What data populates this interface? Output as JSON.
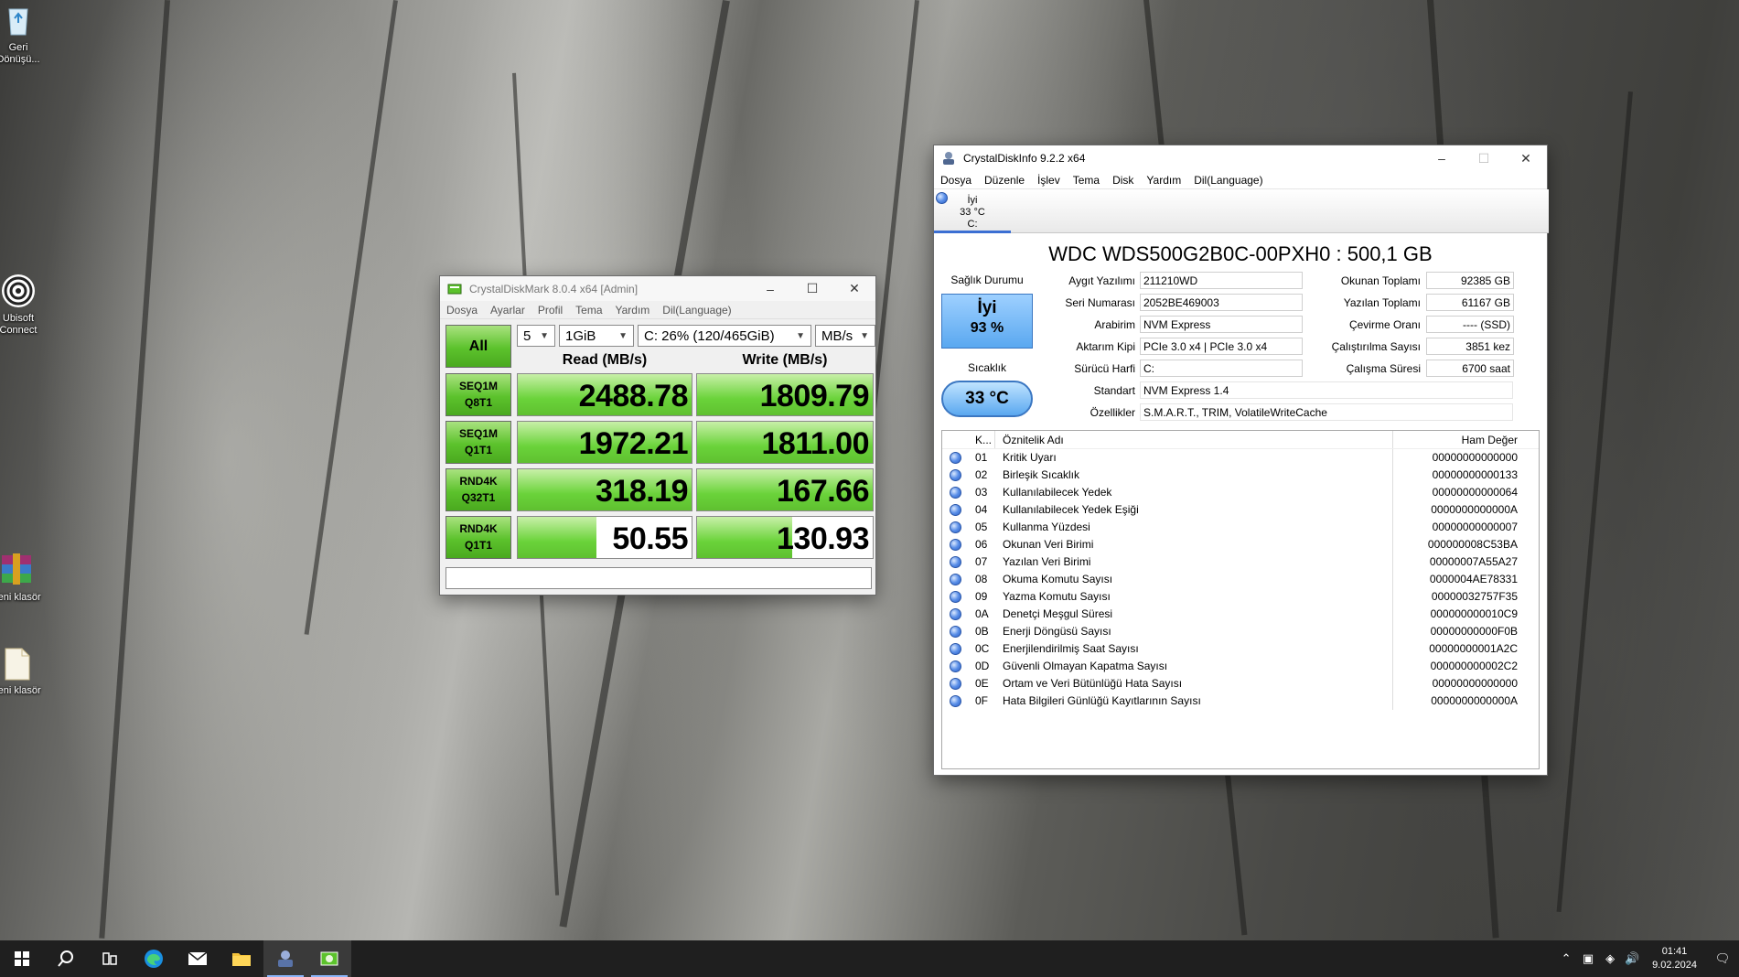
{
  "desktop": {
    "icons": [
      {
        "label": "Geri Dönüşü..."
      },
      {
        "label": "Ubisoft Connect"
      },
      {
        "label": "Yeni klasör"
      },
      {
        "label": "Yeni klasör"
      }
    ]
  },
  "cdm": {
    "title": "CrystalDiskMark 8.0.4 x64 [Admin]",
    "menu": [
      "Dosya",
      "Ayarlar",
      "Profil",
      "Tema",
      "Yardım",
      "Dil(Language)"
    ],
    "all_label": "All",
    "count": "5",
    "size": "1GiB",
    "drive": "C: 26% (120/465GiB)",
    "unit": "MB/s",
    "read_header": "Read (MB/s)",
    "write_header": "Write (MB/s)",
    "rows": [
      {
        "l1": "SEQ1M",
        "l2": "Q8T1",
        "read": "2488.78",
        "write": "1809.79",
        "read_fill": 1.0,
        "write_fill": 1.0
      },
      {
        "l1": "SEQ1M",
        "l2": "Q1T1",
        "read": "1972.21",
        "write": "1811.00",
        "read_fill": 1.0,
        "write_fill": 1.0
      },
      {
        "l1": "RND4K",
        "l2": "Q32T1",
        "read": "318.19",
        "write": "167.66",
        "read_fill": 1.0,
        "write_fill": 1.0
      },
      {
        "l1": "RND4K",
        "l2": "Q1T1",
        "read": "50.55",
        "write": "130.93",
        "read_fill": 0.45,
        "write_fill": 0.54
      }
    ]
  },
  "cdi": {
    "title": "CrystalDiskInfo 9.2.2 x64",
    "menu": [
      "Dosya",
      "Düzenle",
      "İşlev",
      "Tema",
      "Disk",
      "Yardım",
      "Dil(Language)"
    ],
    "tab": {
      "status": "İyi",
      "temp": "33 °C",
      "drive": "C:"
    },
    "model": "WDC WDS500G2B0C-00PXH0 : 500,1 GB",
    "health_label": "Sağlık Durumu",
    "health_status": "İyi",
    "health_percent": "93 %",
    "temp_label": "Sıcaklık",
    "temp_value": "33 °C",
    "fields": {
      "firmware_label": "Aygıt Yazılımı",
      "firmware": "211210WD",
      "serial_label": "Seri Numarası",
      "serial": "2052BE469003",
      "interface_label": "Arabirim",
      "interface": "NVM Express",
      "transfer_label": "Aktarım Kipi",
      "transfer": "PCIe 3.0 x4 | PCIe 3.0 x4",
      "drive_label": "Sürücü Harfi",
      "drive": "C:",
      "standard_label": "Standart",
      "standard": "NVM Express 1.4",
      "features_label": "Özellikler",
      "features": "S.M.A.R.T., TRIM, VolatileWriteCache",
      "host_reads_label": "Okunan Toplamı",
      "host_reads": "92385 GB",
      "host_writes_label": "Yazılan Toplamı",
      "host_writes": "61167 GB",
      "rotation_label": "Çevirme Oranı",
      "rotation": "---- (SSD)",
      "power_count_label": "Çalıştırılma Sayısı",
      "power_count": "3851 kez",
      "power_hours_label": "Çalışma Süresi",
      "power_hours": "6700 saat"
    },
    "table": {
      "col_id": "K...",
      "col_name": "Öznitelik Adı",
      "col_raw": "Ham Değer",
      "rows": [
        {
          "id": "01",
          "name": "Kritik Uyarı",
          "raw": "00000000000000"
        },
        {
          "id": "02",
          "name": "Birleşik Sıcaklık",
          "raw": "00000000000133"
        },
        {
          "id": "03",
          "name": "Kullanılabilecek Yedek",
          "raw": "00000000000064"
        },
        {
          "id": "04",
          "name": "Kullanılabilecek Yedek Eşiği",
          "raw": "0000000000000A"
        },
        {
          "id": "05",
          "name": "Kullanma Yüzdesi",
          "raw": "00000000000007"
        },
        {
          "id": "06",
          "name": "Okunan Veri Birimi",
          "raw": "000000008C53BA"
        },
        {
          "id": "07",
          "name": "Yazılan Veri Birimi",
          "raw": "00000007A55A27"
        },
        {
          "id": "08",
          "name": "Okuma Komutu Sayısı",
          "raw": "0000004AE78331"
        },
        {
          "id": "09",
          "name": "Yazma Komutu Sayısı",
          "raw": "00000032757F35"
        },
        {
          "id": "0A",
          "name": "Denetçi Meşgul Süresi",
          "raw": "000000000010C9"
        },
        {
          "id": "0B",
          "name": "Enerji Döngüsü Sayısı",
          "raw": "00000000000F0B"
        },
        {
          "id": "0C",
          "name": "Enerjilendirilmiş Saat Sayısı",
          "raw": "00000000001A2C"
        },
        {
          "id": "0D",
          "name": "Güvenli Olmayan Kapatma Sayısı",
          "raw": "000000000002C2"
        },
        {
          "id": "0E",
          "name": "Ortam ve Veri Bütünlüğü Hata Sayısı",
          "raw": "00000000000000"
        },
        {
          "id": "0F",
          "name": "Hata Bilgileri Günlüğü Kayıtlarının Sayısı",
          "raw": "0000000000000A"
        }
      ]
    }
  },
  "taskbar": {
    "time": "01:41",
    "date": "9.02.2024"
  },
  "colors": {
    "cdm_green": "#5cc22c",
    "cdi_blue": "#5aa8f0",
    "taskbar": "#1f1f1f"
  }
}
